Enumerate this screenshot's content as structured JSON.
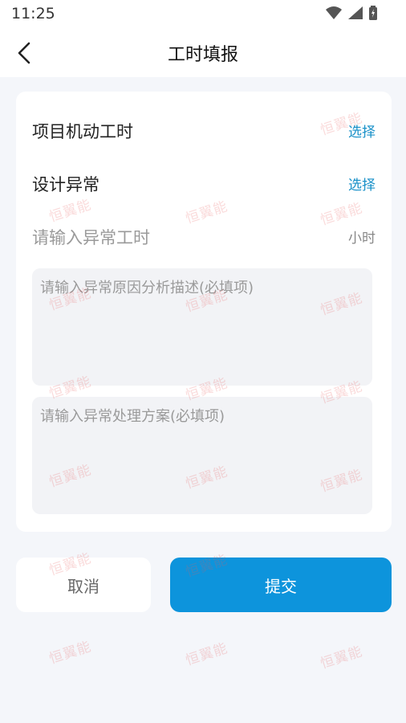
{
  "status": {
    "time": "11:25"
  },
  "header": {
    "title": "工时填报"
  },
  "form": {
    "project_row": {
      "label": "项目机动工时",
      "action": "选择"
    },
    "design_row": {
      "label": "设计异常",
      "action": "选择"
    },
    "hours": {
      "placeholder": "请输入异常工时",
      "unit": "小时"
    },
    "reason": {
      "placeholder": "请输入异常原因分析描述(必填项)"
    },
    "solution": {
      "placeholder": "请输入异常处理方案(必填项)"
    }
  },
  "buttons": {
    "cancel": "取消",
    "submit": "提交"
  },
  "watermark": "恒翼能",
  "colors": {
    "accent": "#0d94dc",
    "link": "#1890c8"
  }
}
